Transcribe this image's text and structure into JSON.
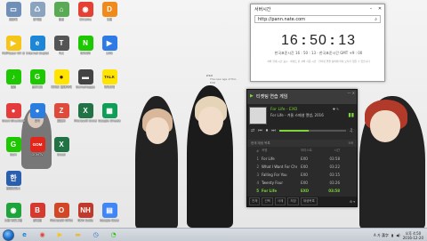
{
  "desktop": {
    "icons": [
      {
        "label": "컴퓨터",
        "glyph": "▭",
        "color": "#6f8fb8"
      },
      {
        "label": "휴지통",
        "glyph": "♺",
        "color": "#8aa4c0"
      },
      {
        "label": "명상",
        "glyph": "⌂",
        "color": "#5aaa55"
      },
      {
        "label": "Chrome",
        "glyph": "◉",
        "color": "#e44134"
      },
      {
        "label": "다음",
        "glyph": "D",
        "color": "#f08a1c"
      },
      {
        "label": "PotPlayer 64 bit",
        "glyph": "▶",
        "color": "#f5c518"
      },
      {
        "label": "Internet Explorer",
        "glyph": "e",
        "color": "#1d86d6"
      },
      {
        "label": "TLC",
        "glyph": "T",
        "color": "#555555"
      },
      {
        "label": "NAVER",
        "glyph": "N",
        "color": "#1ec800"
      },
      {
        "label": "LIVE",
        "glyph": "▶",
        "color": "#2e7be5"
      },
      {
        "label": "멜론",
        "glyph": "♪",
        "color": "#1ec800"
      },
      {
        "label": "곰오디오",
        "glyph": "G",
        "color": "#1ec800"
      },
      {
        "label": "카카오 플레이어",
        "glyph": "●",
        "color": "#ffe400"
      },
      {
        "label": "GameHappy",
        "glyph": "▬",
        "color": "#444444"
      },
      {
        "label": "카카오톡",
        "glyph": "TALK",
        "color": "#ffe400"
      },
      {
        "label": "Good Bluetooth",
        "glyph": "●",
        "color": "#e63b3b"
      },
      {
        "label": "알약",
        "glyph": "●",
        "color": "#2b7de0"
      },
      {
        "label": "알툴즈",
        "glyph": "Z",
        "color": "#e04a3a"
      },
      {
        "label": "Microsoft Excel",
        "glyph": "X",
        "color": "#217346"
      },
      {
        "label": "Google Sheets",
        "glyph": "▦",
        "color": "#0f9d58"
      },
      {
        "label": "Gom",
        "glyph": "G",
        "color": "#1ec800"
      },
      {
        "label": "GOMTV",
        "glyph": "GOM",
        "color": "#e2261c"
      },
      {
        "label": "Excel",
        "glyph": "X",
        "color": "#217346"
      },
      {
        "label": "한컴오피스",
        "glyph": "한",
        "color": "#2a5fb0"
      },
      {
        "label": "스캔 프로그램",
        "glyph": "◉",
        "color": "#1ea43a"
      },
      {
        "label": "반디캠",
        "glyph": "B",
        "color": "#d63a2f"
      },
      {
        "label": "Microsoft Office",
        "glyph": "O",
        "color": "#d24726"
      },
      {
        "label": "NKH Suite",
        "glyph": "NH",
        "color": "#c0392b"
      },
      {
        "label": "Google Docs",
        "glyph": "▤",
        "color": "#4285f4"
      }
    ]
  },
  "wallpaper": {
    "caption_lines": [
      "The new age of Exo",
      "",
      "EXO"
    ],
    "signature": "exo"
  },
  "clock_window": {
    "title": "서버시간",
    "url": "http://pann.nate.com",
    "hour": "16",
    "minute": "50",
    "second": "13",
    "sub": "한국표준시간 16 : 50 : 13 · 한국표준시간 GMT +9 : 00",
    "notes": "서버 현재 시간 표시 · 네이트 판 서버 기준 시간 · 인터넷 연결 상태에 따라 오차가 생길 수 있습니다"
  },
  "player": {
    "notice": "티켓팅 연습 게임",
    "now_title": "For Life - EXO",
    "now_album": "For Life - 겨울 스페셜 앨범, 2016",
    "badge": "♥ ✎",
    "list_header": "현재 재생 목록",
    "list_count": "5곡",
    "columns": {
      "num": "#",
      "title": "곡명",
      "artist": "아티스트",
      "time": "시간"
    },
    "tracks": [
      {
        "num": "1",
        "title": "For Life",
        "artist": "EXO",
        "time": "03:58"
      },
      {
        "num": "2",
        "title": "What I Want For Christ...",
        "artist": "EXO",
        "time": "03:22"
      },
      {
        "num": "3",
        "title": "Falling For You",
        "artist": "EXO",
        "time": "03:15"
      },
      {
        "num": "4",
        "title": "Twenty Four",
        "artist": "EXO",
        "time": "03:26"
      },
      {
        "num": "5",
        "title": "For Life",
        "artist": "EXO",
        "time": "03:58"
      }
    ],
    "active_index": 4,
    "progress": 0.45,
    "bottom_buttons": [
      "전체",
      "선택",
      "삭제",
      "저장",
      "재생목록"
    ],
    "bottom_right": "⚙ ▾"
  },
  "taskbar": {
    "apps": [
      {
        "name": "ie",
        "glyph": "e",
        "color": "#1d86d6"
      },
      {
        "name": "chrome",
        "glyph": "◉",
        "color": "#e44134"
      },
      {
        "name": "potplayer",
        "glyph": "▶",
        "color": "#f5c518"
      },
      {
        "name": "folder",
        "glyph": "▬",
        "color": "#e8b945"
      },
      {
        "name": "clock",
        "glyph": "◷",
        "color": "#2a6fd0"
      },
      {
        "name": "green-app",
        "glyph": "◔",
        "color": "#1ec800"
      }
    ],
    "lang": "A 가 漢字",
    "tray_time": "오후 4:50",
    "tray_date": "2016-12-20"
  }
}
